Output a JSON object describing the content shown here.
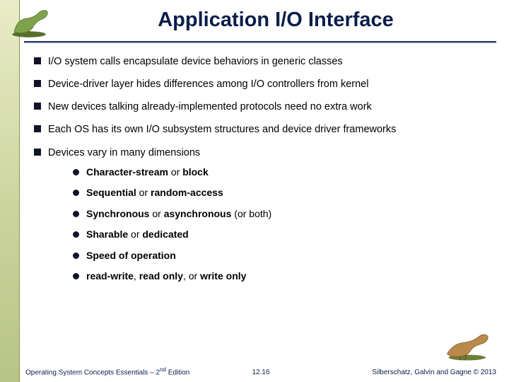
{
  "title": "Application I/O Interface",
  "bullets": [
    {
      "text": "I/O system calls encapsulate device behaviors in generic classes"
    },
    {
      "text": "Device-driver layer hides differences among I/O controllers from kernel"
    },
    {
      "text": "New devices talking already-implemented protocols need no extra work"
    },
    {
      "text": "Each OS has its own I/O subsystem structures and device driver frameworks"
    },
    {
      "text": "Devices vary in many dimensions",
      "sub": [
        {
          "parts": [
            {
              "t": "Character-stream",
              "b": true
            },
            {
              "t": " or ",
              "b": false
            },
            {
              "t": "block",
              "b": true
            }
          ]
        },
        {
          "parts": [
            {
              "t": "Sequential",
              "b": true
            },
            {
              "t": " or ",
              "b": false
            },
            {
              "t": "random-access",
              "b": true
            }
          ]
        },
        {
          "parts": [
            {
              "t": "Synchronous",
              "b": true
            },
            {
              "t": " or ",
              "b": false
            },
            {
              "t": "asynchronous",
              "b": true
            },
            {
              "t": " (or both)",
              "b": false
            }
          ]
        },
        {
          "parts": [
            {
              "t": "Sharable",
              "b": true
            },
            {
              "t": " or ",
              "b": false
            },
            {
              "t": "dedicated",
              "b": true
            }
          ]
        },
        {
          "parts": [
            {
              "t": "Speed of operation",
              "b": true
            }
          ]
        },
        {
          "parts": [
            {
              "t": "read-write",
              "b": true
            },
            {
              "t": ", ",
              "b": false
            },
            {
              "t": "read only",
              "b": true
            },
            {
              "t": ", or ",
              "b": false
            },
            {
              "t": "write only",
              "b": true
            }
          ]
        }
      ]
    }
  ],
  "footer": {
    "left_prefix": "Operating System Concepts Essentials – 2",
    "left_sup": "nd",
    "left_suffix": " Edition",
    "center": "12.16",
    "right": "Silberschatz, Galvin and Gagne © 2013"
  }
}
